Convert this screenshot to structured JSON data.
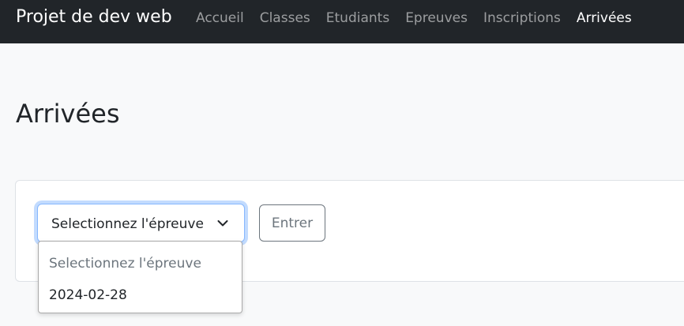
{
  "navbar": {
    "brand": "Projet de dev web",
    "links": [
      {
        "label": "Accueil"
      },
      {
        "label": "Classes"
      },
      {
        "label": "Etudiants"
      },
      {
        "label": "Epreuves"
      },
      {
        "label": "Inscriptions"
      },
      {
        "label": "Arrivées",
        "active": true
      }
    ]
  },
  "page": {
    "title": "Arrivées"
  },
  "form": {
    "select": {
      "selected": "Selectionnez l'épreuve",
      "icon": "chevron-down-icon",
      "options": [
        "Selectionnez l'épreuve",
        "2024-02-28"
      ]
    },
    "submit_label": "Entrer"
  },
  "colors": {
    "navbar_bg": "#212529",
    "page_bg": "#f8f9fa",
    "focus_ring": "#86b7fe",
    "muted": "#6c757d"
  }
}
